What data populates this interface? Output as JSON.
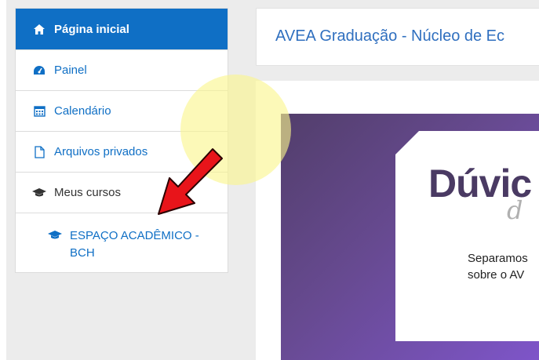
{
  "sidebar": {
    "items": [
      {
        "label": "Página inicial",
        "icon": "home-icon"
      },
      {
        "label": "Painel",
        "icon": "dashboard-icon"
      },
      {
        "label": "Calendário",
        "icon": "calendar-icon"
      },
      {
        "label": "Arquivos privados",
        "icon": "file-icon"
      },
      {
        "label": "Meus cursos",
        "icon": "graduation-cap-icon"
      },
      {
        "label": "ESPAÇO ACADÊMICO - BCH",
        "icon": "graduation-cap-icon"
      }
    ]
  },
  "header": {
    "title": "AVEA Graduação - Núcleo de Ec"
  },
  "banner": {
    "title": "Dúvic",
    "script": "d",
    "text_line1": "Separamos",
    "text_line2": "sobre o AV"
  },
  "colors": {
    "accent": "#0f6fc5",
    "arrow": "#e8141a",
    "highlight": "#faf58c"
  }
}
